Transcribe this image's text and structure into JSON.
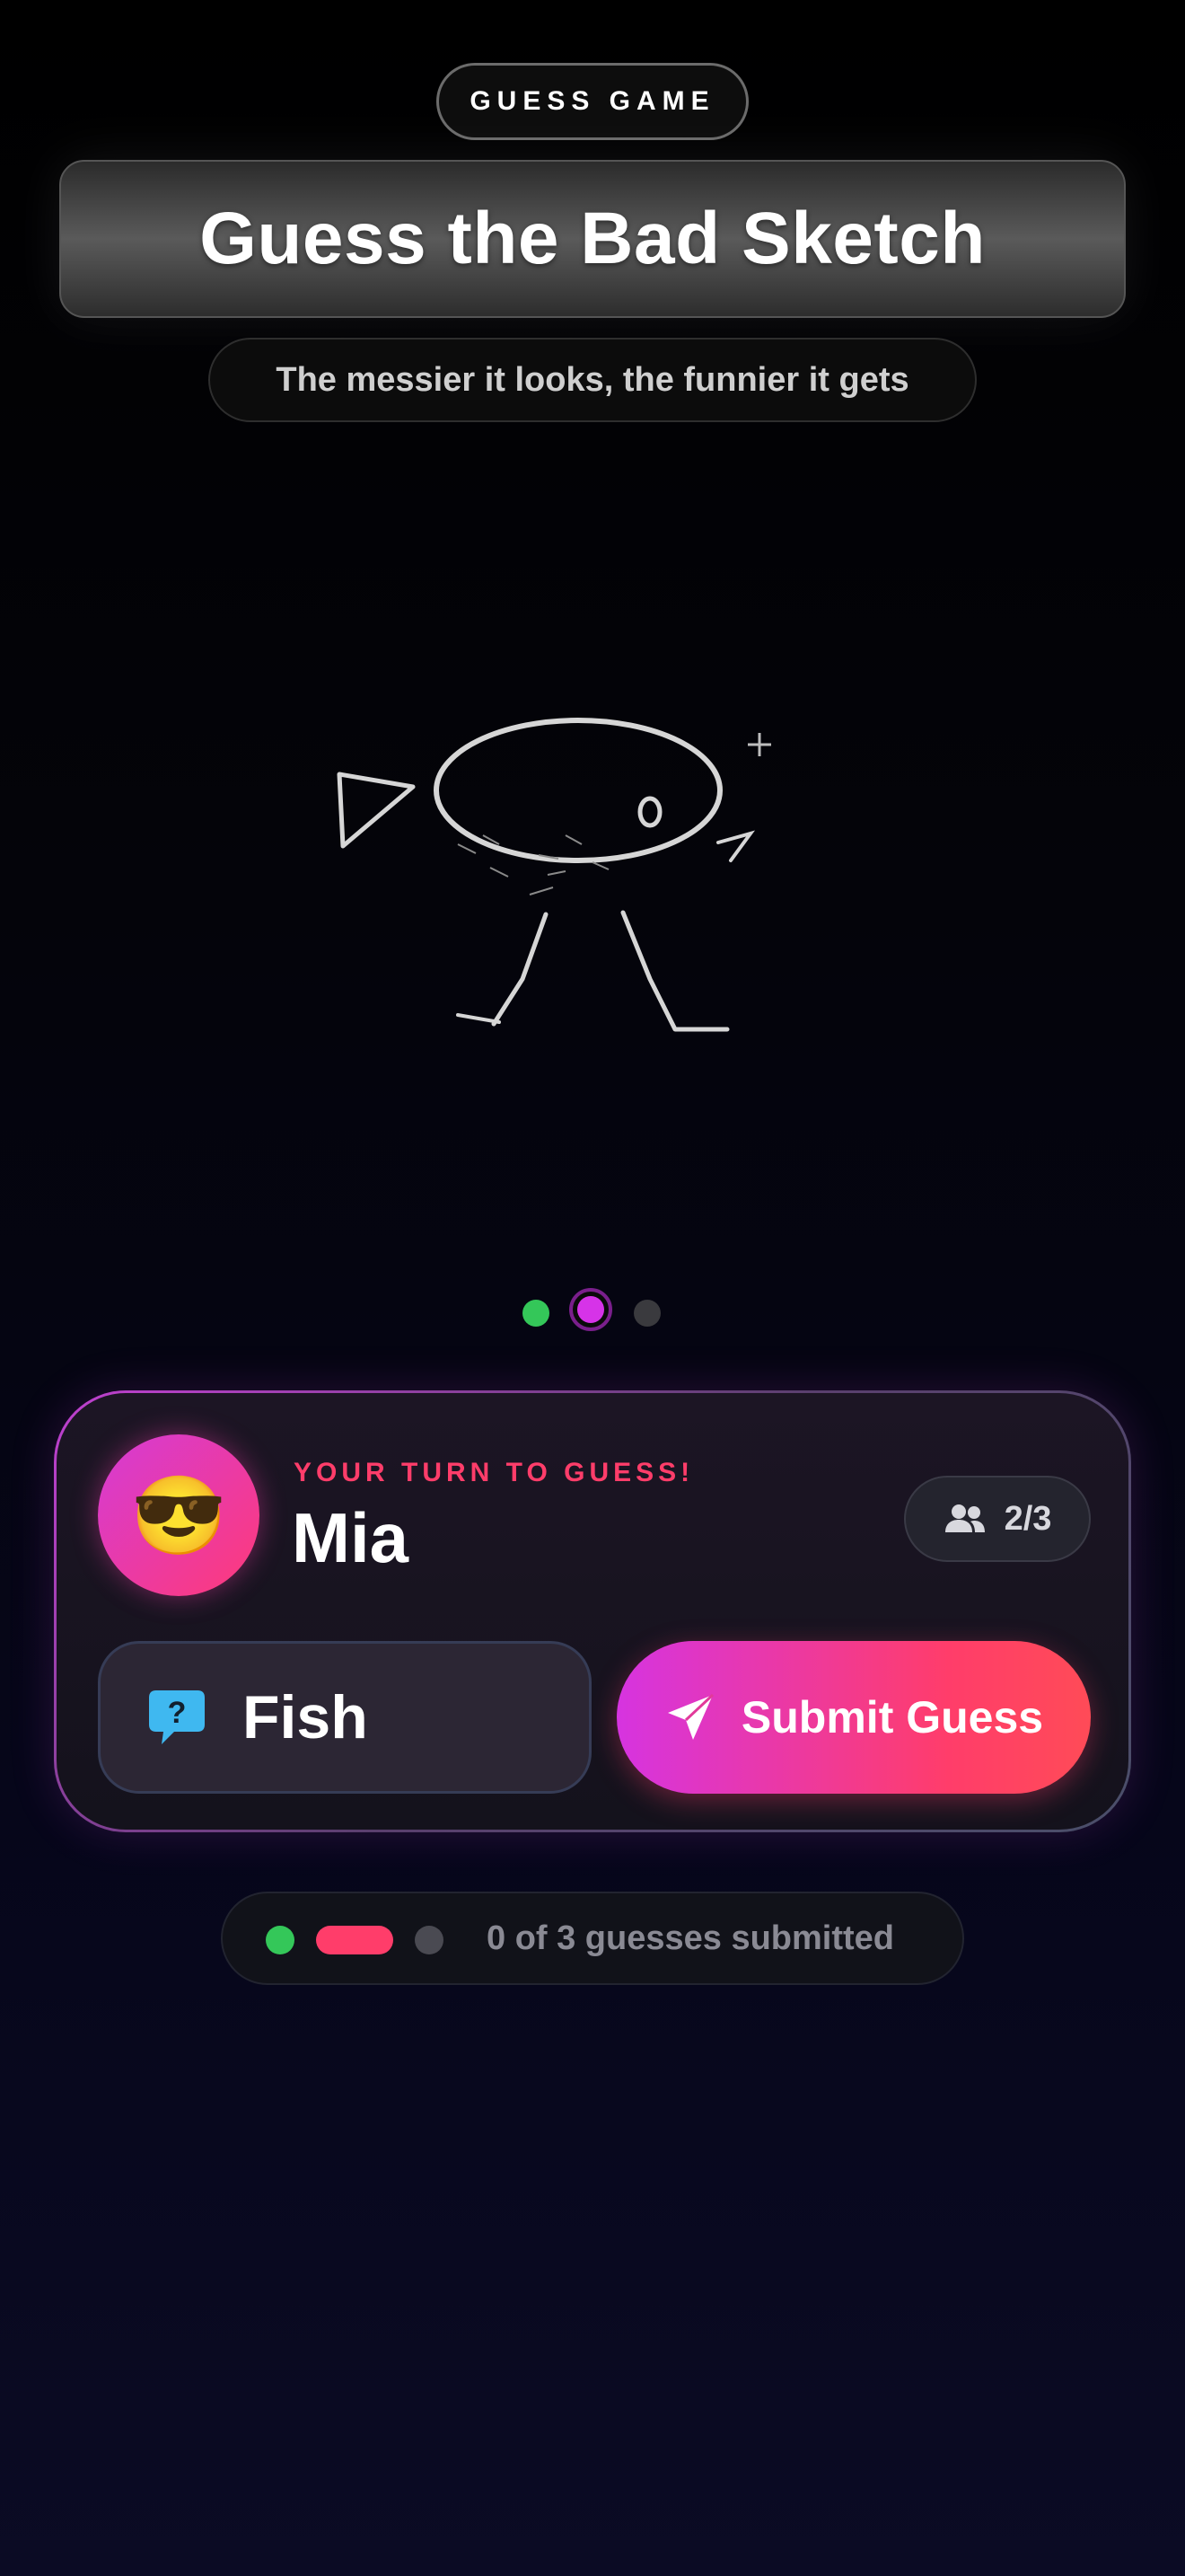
{
  "header": {
    "badge": "GUESS GAME",
    "title": "Guess the Bad Sketch",
    "subtitle": "The messier it looks, the funnier it gets"
  },
  "sketch": {
    "icon": "fish-doodle"
  },
  "carousel": {
    "total": 3,
    "active_index": 1
  },
  "turn_card": {
    "avatar_emoji": "😎",
    "prompt": "YOUR TURN TO GUESS!",
    "player_name": "Mia",
    "player_count": "2/3",
    "player_count_icon": "people-icon",
    "guess_icon": "question-bubble-icon",
    "guess_value": "Fish",
    "submit_label": "Submit Guess",
    "submit_icon": "paper-plane-icon"
  },
  "status": {
    "text": "0 of 3 guesses submitted"
  },
  "colors": {
    "accent_pink": "#ff3d6a",
    "accent_magenta": "#d634e0",
    "success_green": "#34c759",
    "question_blue": "#3fb8f0"
  }
}
